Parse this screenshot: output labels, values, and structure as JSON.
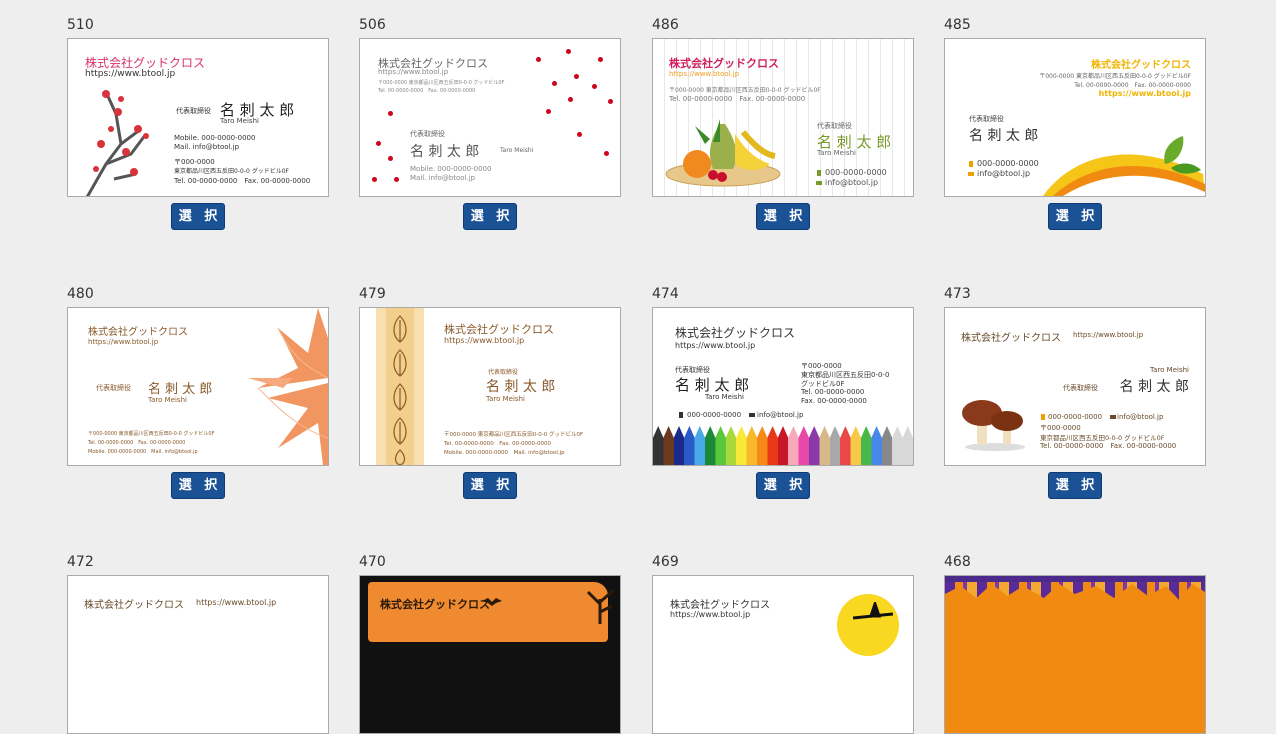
{
  "select_label": "選 択",
  "cards": [
    {
      "id": "510",
      "company": "株式会社グッドクロス",
      "url": "https://www.btool.jp",
      "title": "代表取締役",
      "name": "名 刺 太 郎",
      "romaji": "Taro Meishi",
      "mobile": "Mobile. 000-0000-0000",
      "mail": "Mail. info@btool.jp",
      "zip": "〒000-0000",
      "address": "東京都品川区西五反田0-0-0 グッドビル0F",
      "tel": "Tel. 00-0000-0000　Fax. 00-0000-0000"
    },
    {
      "id": "506",
      "company": "株式会社グッドクロス",
      "url": "https://www.btool.jp",
      "address": "〒000-0000 東京都品川区西五反田0-0-0 グッドビル0F",
      "telfax": "Tel. 00-0000-0000　Fax. 00-0000-0000",
      "title": "代表取締役",
      "name": "名 刺 太 郎",
      "romaji": "Taro Meishi",
      "mobile": "Mobile. 000-0000-0000",
      "mail": "Mail. info@btool.jp"
    },
    {
      "id": "486",
      "company": "株式会社グッドクロス",
      "url": "https://www.btool.jp",
      "address": "〒000-0000 東京都品川区西五反田0-0-0 グッドビル0F",
      "telfax": "Tel. 00-0000-0000　Fax. 00-0000-0000",
      "title": "代表取締役",
      "name": "名 刺 太 郎",
      "romaji": "Taro Meishi",
      "phone": "000-0000-0000",
      "mail": "info@btool.jp"
    },
    {
      "id": "485",
      "company": "株式会社グッドクロス",
      "address": "〒000-0000 東京都品川区西五反田0-0-0 グッドビル0F",
      "telfax": "Tel. 00-0000-0000　Fax. 00-0000-0000",
      "url": "https://www.btool.jp",
      "title": "代表取締役",
      "name": "名 刺 太 郎",
      "phone": "000-0000-0000",
      "mail": "info@btool.jp"
    },
    {
      "id": "480",
      "company": "株式会社グッドクロス",
      "url": "https://www.btool.jp",
      "title": "代表取締役",
      "name": "名 刺 太 郎",
      "romaji": "Taro Meishi",
      "address": "〒000-0000 東京都品川区西五反田0-0-0 グッドビル0F",
      "tel": "Tel. 00-0000-0000　Fax. 00-0000-0000",
      "mobile": "Mobile. 000-0000-0000　Mail. info@btool.jp"
    },
    {
      "id": "479",
      "company": "株式会社グッドクロス",
      "url": "https://www.btool.jp",
      "title": "代表取締役",
      "name": "名 刺 太 郎",
      "romaji": "Taro Meishi",
      "address": "〒000-0000 東京都品川区西五反田0-0-0 グッドビル0F",
      "telfax": "Tel. 00-0000-0000　Fax. 00-0000-0000",
      "mobile": "Mobile. 000-0000-0000　Mail. info@btool.jp"
    },
    {
      "id": "474",
      "company": "株式会社グッドクロス",
      "url": "https://www.btool.jp",
      "title": "代表取締役",
      "name": "名 刺 太 郎",
      "romaji": "Taro Meishi",
      "zip": "〒000-0000",
      "address1": "東京都品川区西五反田0-0-0",
      "address2": "グッドビル0F",
      "tel": "Tel. 00-0000-0000",
      "fax": "Fax. 00-0000-0000",
      "phone": "000-0000-0000",
      "mail": "info@btool.jp"
    },
    {
      "id": "473",
      "company": "株式会社グッドクロス",
      "url": "https://www.btool.jp",
      "romaji": "Taro Meishi",
      "title": "代表取締役",
      "name": "名 刺 太 郎",
      "phone": "000-0000-0000",
      "mail": "info@btool.jp",
      "zip": "〒000-0000",
      "address": "東京都品川区西五反田0-0-0 グッドビル0F",
      "telfax": "Tel. 00-0000-0000　Fax. 00-0000-0000"
    },
    {
      "id": "472",
      "company": "株式会社グッドクロス",
      "url": "https://www.btool.jp"
    },
    {
      "id": "470",
      "company": "株式会社グッドクロス"
    },
    {
      "id": "469",
      "company": "株式会社グッドクロス",
      "url": "https://www.btool.jp"
    },
    {
      "id": "468"
    }
  ]
}
